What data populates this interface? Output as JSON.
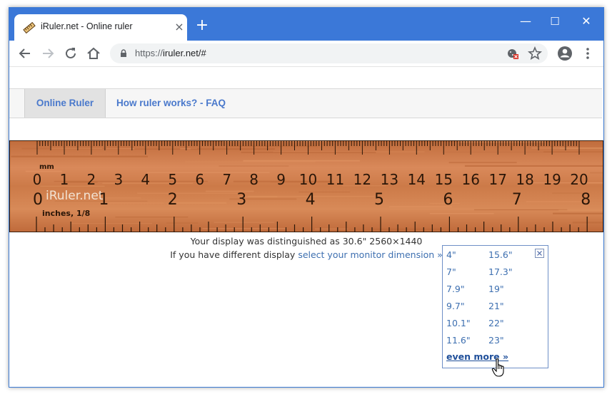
{
  "browser": {
    "tab_title": "iRuler.net - Online ruler",
    "tab_close": "×",
    "new_tab": "+",
    "url_scheme": "https://",
    "url_rest": "iruler.net/#",
    "window_controls": {
      "minimize": "—",
      "maximize": "☐",
      "close": "✕"
    }
  },
  "nav": {
    "tabs": [
      {
        "label": "Online Ruler",
        "active": true
      },
      {
        "label": "How ruler works? - FAQ",
        "active": false
      }
    ]
  },
  "ruler": {
    "mm_label": "mm",
    "cm_numbers": [
      "0",
      "1",
      "2",
      "3",
      "4",
      "5",
      "6",
      "7",
      "8",
      "9",
      "10",
      "11",
      "12",
      "13",
      "14",
      "15",
      "16",
      "17",
      "18",
      "19",
      "20"
    ],
    "brand": "iRuler.net",
    "inch_zero": "0",
    "inch_numbers": [
      "1",
      "2",
      "3",
      "4",
      "5",
      "6",
      "7",
      "8"
    ],
    "inch_label": "inches, 1/8",
    "wood_color": "#cf7c49"
  },
  "info": {
    "detected_prefix": "Your display was distinguished as",
    "detected_value": "30.6\" 2560×1440",
    "different_prefix": "If you have different display",
    "select_link": "select your monitor dimension »"
  },
  "monitor_panel": {
    "close": "✕",
    "col1": [
      "4\"",
      "7\"",
      "7.9\"",
      "9.7\"",
      "10.1\"",
      "11.6\""
    ],
    "col2": [
      "15.6\"",
      "17.3\"",
      "19\"",
      "21\"",
      "22\"",
      "23\""
    ],
    "even_more": "even more »"
  },
  "colors": {
    "titlebar": "#3b78d8",
    "link": "#3d6fb0",
    "nav_link": "#4a79cc"
  }
}
